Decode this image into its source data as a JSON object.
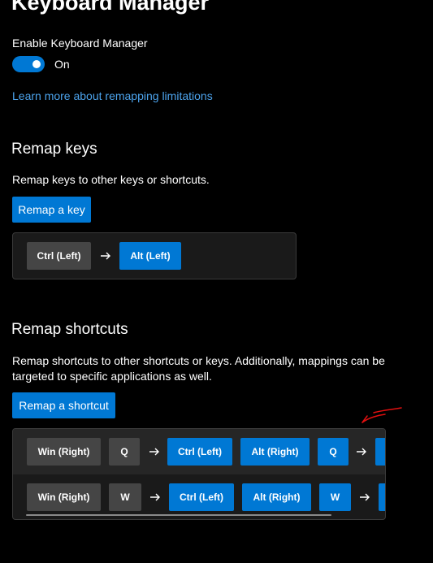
{
  "header": {
    "title": "Keyboard Manager"
  },
  "enable": {
    "label": "Enable Keyboard Manager",
    "state": "On"
  },
  "learn_more": "Learn more about remapping limitations",
  "remap_keys": {
    "heading": "Remap keys",
    "description": "Remap keys to other keys or shortcuts.",
    "button": "Remap a key",
    "mappings": [
      {
        "from": "Ctrl (Left)",
        "to": "Alt (Left)"
      }
    ]
  },
  "remap_shortcuts": {
    "heading": "Remap shortcuts",
    "description_line1": "Remap shortcuts to other shortcuts or keys. Additionally, mappings can be",
    "description_line2": "targeted to specific applications as well.",
    "button": "Remap a shortcut",
    "rows": [
      {
        "from": [
          "Win (Right)",
          "Q"
        ],
        "to": [
          "Ctrl (Left)",
          "Alt (Right)",
          "Q"
        ]
      },
      {
        "from": [
          "Win (Right)",
          "W"
        ],
        "to": [
          "Ctrl (Left)",
          "Alt (Right)",
          "W"
        ]
      }
    ]
  },
  "annotation": {
    "icon": "red-arrow-annotation-icon",
    "color": "#e01010"
  },
  "colors": {
    "accent": "#0078d4",
    "link": "#4ca3ec",
    "key_source": "#454545"
  }
}
